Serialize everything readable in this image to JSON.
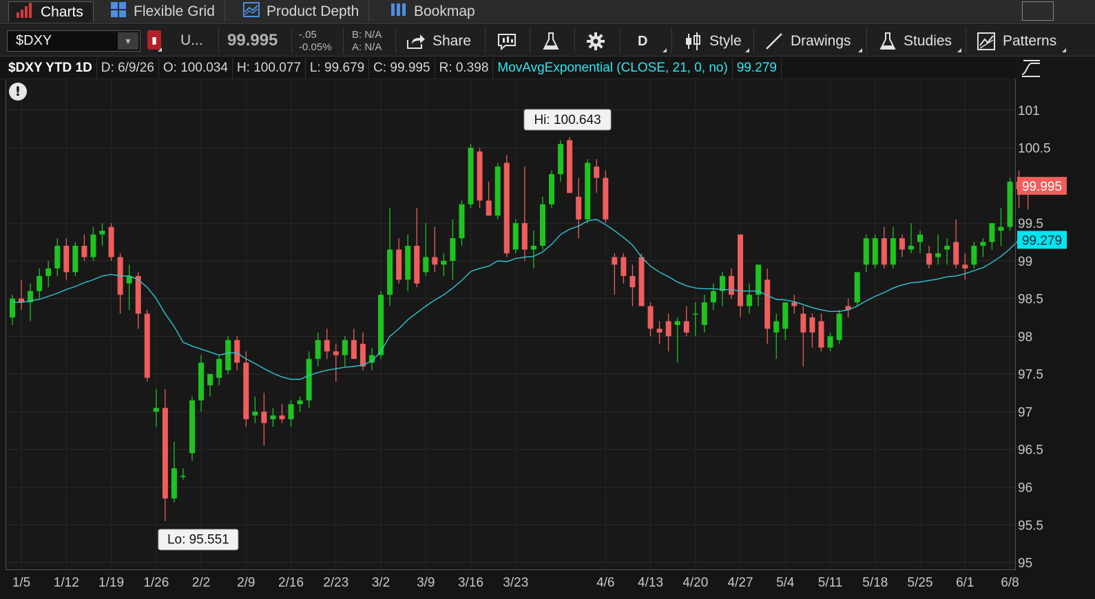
{
  "tabs": [
    {
      "label": "Charts",
      "active": true
    },
    {
      "label": "Flexible Grid",
      "active": false
    },
    {
      "label": "Product Depth",
      "active": false
    },
    {
      "label": "Bookmap",
      "active": false
    }
  ],
  "toolbar": {
    "symbol": "$DXY",
    "description": "U...",
    "last": "99.995",
    "net_change": "-.05",
    "pct_change": "-0.05%",
    "bid": "B: N/A",
    "ask": "A: N/A",
    "share_label": "Share",
    "aggregation": "D",
    "style_label": "Style",
    "drawings_label": "Drawings",
    "studies_label": "Studies",
    "patterns_label": "Patterns"
  },
  "infobar": {
    "title": "$DXY YTD 1D",
    "date": "D: 6/9/26",
    "open": "O: 100.034",
    "high": "H: 100.077",
    "low": "L: 99.679",
    "close": "C: 99.995",
    "range": "R: 0.398",
    "study": "MovAvgExponential (CLOSE, 21, 0, no)",
    "study_value": "99.279"
  },
  "colors": {
    "up": "#1fc31f",
    "down": "#ef5d5d",
    "ema": "#2ec7d3",
    "price_bubble": "#ef5d5d",
    "ema_bubble": "#00e5f0"
  },
  "chart_data": {
    "type": "candlestick",
    "title": "$DXY YTD 1D",
    "ylim": [
      94.9,
      101.4
    ],
    "y_ticks": [
      "95",
      "95.5",
      "96",
      "96.5",
      "97",
      "97.5",
      "98",
      "98.5",
      "99",
      "99.5",
      "100.5",
      "101"
    ],
    "x_tick_labels": [
      {
        "label": "1/5",
        "index": 1
      },
      {
        "label": "1/12",
        "index": 6
      },
      {
        "label": "1/19",
        "index": 11
      },
      {
        "label": "1/26",
        "index": 16
      },
      {
        "label": "2/2",
        "index": 21
      },
      {
        "label": "2/9",
        "index": 26
      },
      {
        "label": "2/16",
        "index": 31
      },
      {
        "label": "2/23",
        "index": 36
      },
      {
        "label": "3/2",
        "index": 41
      },
      {
        "label": "3/9",
        "index": 46
      },
      {
        "label": "3/16",
        "index": 51
      },
      {
        "label": "3/23",
        "index": 56
      },
      {
        "label": "4/6",
        "index": 66
      },
      {
        "label": "4/13",
        "index": 71
      },
      {
        "label": "4/20",
        "index": 76
      },
      {
        "label": "4/27",
        "index": 81
      },
      {
        "label": "5/4",
        "index": 86
      },
      {
        "label": "5/11",
        "index": 91
      },
      {
        "label": "5/18",
        "index": 96
      },
      {
        "label": "5/25",
        "index": 101
      },
      {
        "label": "6/1",
        "index": 106
      },
      {
        "label": "6/8",
        "index": 111
      }
    ],
    "hi_label": "Hi: 100.643",
    "hi_index": 61,
    "hi_value": 100.643,
    "lo_label": "Lo: 95.551",
    "lo_index": 17,
    "lo_value": 95.551,
    "last_price_label": "99.995",
    "last_price": 99.995,
    "ema_label": "99.279",
    "ema_last": 99.279,
    "candles": [
      {
        "o": 98.25,
        "h": 98.55,
        "l": 98.15,
        "c": 98.5
      },
      {
        "o": 98.5,
        "h": 98.75,
        "l": 98.35,
        "c": 98.45
      },
      {
        "o": 98.45,
        "h": 98.7,
        "l": 98.2,
        "c": 98.6
      },
      {
        "o": 98.6,
        "h": 98.9,
        "l": 98.5,
        "c": 98.8
      },
      {
        "o": 98.8,
        "h": 99.0,
        "l": 98.65,
        "c": 98.9
      },
      {
        "o": 98.9,
        "h": 99.3,
        "l": 98.8,
        "c": 99.2
      },
      {
        "o": 99.2,
        "h": 99.3,
        "l": 98.75,
        "c": 98.85
      },
      {
        "o": 98.85,
        "h": 99.25,
        "l": 98.8,
        "c": 99.2
      },
      {
        "o": 99.2,
        "h": 99.35,
        "l": 99.0,
        "c": 99.05
      },
      {
        "o": 99.05,
        "h": 99.45,
        "l": 99.0,
        "c": 99.35
      },
      {
        "o": 99.35,
        "h": 99.5,
        "l": 99.2,
        "c": 99.4
      },
      {
        "o": 99.45,
        "h": 99.5,
        "l": 99.0,
        "c": 99.05
      },
      {
        "o": 99.05,
        "h": 99.1,
        "l": 98.3,
        "c": 98.55
      },
      {
        "o": 98.7,
        "h": 98.95,
        "l": 98.35,
        "c": 98.8
      },
      {
        "o": 98.8,
        "h": 98.85,
        "l": 98.1,
        "c": 98.3
      },
      {
        "o": 98.3,
        "h": 98.35,
        "l": 97.4,
        "c": 97.45
      },
      {
        "o": 97.0,
        "h": 97.3,
        "l": 96.8,
        "c": 97.05
      },
      {
        "o": 97.05,
        "h": 97.3,
        "l": 95.55,
        "c": 95.85
      },
      {
        "o": 95.85,
        "h": 96.6,
        "l": 95.8,
        "c": 96.25
      },
      {
        "o": 96.15,
        "h": 96.25,
        "l": 96.1,
        "c": 96.15
      },
      {
        "o": 96.45,
        "h": 97.2,
        "l": 96.35,
        "c": 97.15
      },
      {
        "o": 97.15,
        "h": 97.75,
        "l": 97.0,
        "c": 97.65
      },
      {
        "o": 97.35,
        "h": 97.5,
        "l": 97.2,
        "c": 97.5
      },
      {
        "o": 97.45,
        "h": 97.75,
        "l": 97.35,
        "c": 97.7
      },
      {
        "o": 97.55,
        "h": 98.0,
        "l": 97.5,
        "c": 97.95
      },
      {
        "o": 97.95,
        "h": 98.0,
        "l": 97.55,
        "c": 97.65
      },
      {
        "o": 97.65,
        "h": 97.8,
        "l": 96.8,
        "c": 96.9
      },
      {
        "o": 96.95,
        "h": 97.2,
        "l": 96.85,
        "c": 97.0
      },
      {
        "o": 97.0,
        "h": 97.25,
        "l": 96.55,
        "c": 96.85
      },
      {
        "o": 96.9,
        "h": 97.05,
        "l": 96.8,
        "c": 96.95
      },
      {
        "o": 96.95,
        "h": 97.1,
        "l": 96.85,
        "c": 96.9
      },
      {
        "o": 96.9,
        "h": 97.15,
        "l": 96.8,
        "c": 97.1
      },
      {
        "o": 97.1,
        "h": 97.2,
        "l": 97.0,
        "c": 97.15
      },
      {
        "o": 97.15,
        "h": 97.8,
        "l": 97.05,
        "c": 97.7
      },
      {
        "o": 97.7,
        "h": 98.05,
        "l": 97.6,
        "c": 97.95
      },
      {
        "o": 97.95,
        "h": 98.1,
        "l": 97.7,
        "c": 97.8
      },
      {
        "o": 97.8,
        "h": 97.9,
        "l": 97.4,
        "c": 97.75
      },
      {
        "o": 97.75,
        "h": 98.0,
        "l": 97.6,
        "c": 97.95
      },
      {
        "o": 97.95,
        "h": 98.1,
        "l": 97.7,
        "c": 97.7
      },
      {
        "o": 97.9,
        "h": 98.05,
        "l": 97.55,
        "c": 97.6
      },
      {
        "o": 97.65,
        "h": 97.85,
        "l": 97.55,
        "c": 97.75
      },
      {
        "o": 97.75,
        "h": 98.6,
        "l": 97.7,
        "c": 98.55
      },
      {
        "o": 98.55,
        "h": 99.7,
        "l": 98.4,
        "c": 99.15
      },
      {
        "o": 99.15,
        "h": 99.3,
        "l": 98.7,
        "c": 98.75
      },
      {
        "o": 98.75,
        "h": 99.35,
        "l": 98.6,
        "c": 99.2
      },
      {
        "o": 99.2,
        "h": 99.7,
        "l": 98.65,
        "c": 98.7
      },
      {
        "o": 98.85,
        "h": 99.5,
        "l": 98.8,
        "c": 99.05
      },
      {
        "o": 99.05,
        "h": 99.45,
        "l": 98.85,
        "c": 98.95
      },
      {
        "o": 98.95,
        "h": 99.1,
        "l": 98.8,
        "c": 99.0
      },
      {
        "o": 99.0,
        "h": 99.55,
        "l": 98.75,
        "c": 99.3
      },
      {
        "o": 99.3,
        "h": 99.8,
        "l": 99.2,
        "c": 99.75
      },
      {
        "o": 99.75,
        "h": 100.55,
        "l": 99.7,
        "c": 100.5
      },
      {
        "o": 100.45,
        "h": 100.5,
        "l": 99.7,
        "c": 99.8
      },
      {
        "o": 99.8,
        "h": 100.05,
        "l": 99.6,
        "c": 99.6
      },
      {
        "o": 99.6,
        "h": 100.3,
        "l": 99.55,
        "c": 100.25
      },
      {
        "o": 100.3,
        "h": 100.4,
        "l": 99.05,
        "c": 99.1
      },
      {
        "o": 99.15,
        "h": 99.55,
        "l": 99.1,
        "c": 99.5
      },
      {
        "o": 99.5,
        "h": 100.25,
        "l": 99.0,
        "c": 99.15
      },
      {
        "o": 99.15,
        "h": 99.4,
        "l": 98.9,
        "c": 99.2
      },
      {
        "o": 99.2,
        "h": 99.85,
        "l": 99.15,
        "c": 99.75
      },
      {
        "o": 99.75,
        "h": 100.2,
        "l": 99.7,
        "c": 100.15
      },
      {
        "o": 100.15,
        "h": 100.6,
        "l": 100.05,
        "c": 100.55
      },
      {
        "o": 100.6,
        "h": 100.64,
        "l": 99.9,
        "c": 99.9
      },
      {
        "o": 99.85,
        "h": 100.1,
        "l": 99.3,
        "c": 99.55
      },
      {
        "o": 99.55,
        "h": 100.35,
        "l": 99.5,
        "c": 100.3
      },
      {
        "o": 100.25,
        "h": 100.35,
        "l": 99.9,
        "c": 100.1
      },
      {
        "o": 100.1,
        "h": 100.2,
        "l": 99.5,
        "c": 99.55
      },
      {
        "o": 99.05,
        "h": 99.1,
        "l": 98.55,
        "c": 98.95
      },
      {
        "o": 99.05,
        "h": 99.1,
        "l": 98.7,
        "c": 98.8
      },
      {
        "o": 98.8,
        "h": 98.95,
        "l": 98.4,
        "c": 98.65
      },
      {
        "o": 99.05,
        "h": 99.1,
        "l": 98.4,
        "c": 98.4
      },
      {
        "o": 98.4,
        "h": 98.45,
        "l": 98.0,
        "c": 98.1
      },
      {
        "o": 98.1,
        "h": 98.2,
        "l": 97.9,
        "c": 98.05
      },
      {
        "o": 98.2,
        "h": 98.3,
        "l": 97.8,
        "c": 98.0
      },
      {
        "o": 98.15,
        "h": 98.25,
        "l": 97.65,
        "c": 98.2
      },
      {
        "o": 98.2,
        "h": 98.4,
        "l": 98.0,
        "c": 98.05
      },
      {
        "o": 98.3,
        "h": 98.45,
        "l": 98.0,
        "c": 98.3
      },
      {
        "o": 98.15,
        "h": 98.55,
        "l": 98.05,
        "c": 98.45
      },
      {
        "o": 98.45,
        "h": 98.7,
        "l": 98.35,
        "c": 98.6
      },
      {
        "o": 98.6,
        "h": 98.85,
        "l": 98.4,
        "c": 98.8
      },
      {
        "o": 98.8,
        "h": 98.9,
        "l": 98.5,
        "c": 98.55
      },
      {
        "o": 99.35,
        "h": 99.35,
        "l": 98.25,
        "c": 98.4
      },
      {
        "o": 98.4,
        "h": 98.7,
        "l": 98.3,
        "c": 98.55
      },
      {
        "o": 98.55,
        "h": 98.95,
        "l": 98.4,
        "c": 98.95
      },
      {
        "o": 98.75,
        "h": 98.9,
        "l": 97.9,
        "c": 98.1
      },
      {
        "o": 98.05,
        "h": 98.3,
        "l": 97.7,
        "c": 98.2
      },
      {
        "o": 98.1,
        "h": 98.45,
        "l": 97.95,
        "c": 98.45
      },
      {
        "o": 98.45,
        "h": 98.55,
        "l": 98.3,
        "c": 98.4
      },
      {
        "o": 98.3,
        "h": 98.4,
        "l": 97.6,
        "c": 98.05
      },
      {
        "o": 98.25,
        "h": 98.3,
        "l": 97.85,
        "c": 98.05
      },
      {
        "o": 98.2,
        "h": 98.3,
        "l": 97.8,
        "c": 97.85
      },
      {
        "o": 97.85,
        "h": 98.05,
        "l": 97.8,
        "c": 98.0
      },
      {
        "o": 97.95,
        "h": 98.35,
        "l": 97.9,
        "c": 98.3
      },
      {
        "o": 98.4,
        "h": 98.5,
        "l": 98.25,
        "c": 98.35
      },
      {
        "o": 98.45,
        "h": 98.85,
        "l": 98.4,
        "c": 98.85
      },
      {
        "o": 98.95,
        "h": 99.35,
        "l": 98.85,
        "c": 99.3
      },
      {
        "o": 98.95,
        "h": 99.35,
        "l": 98.9,
        "c": 99.3
      },
      {
        "o": 99.3,
        "h": 99.45,
        "l": 98.9,
        "c": 98.95
      },
      {
        "o": 98.95,
        "h": 99.45,
        "l": 98.9,
        "c": 99.3
      },
      {
        "o": 99.3,
        "h": 99.35,
        "l": 99.05,
        "c": 99.15
      },
      {
        "o": 99.15,
        "h": 99.5,
        "l": 99.1,
        "c": 99.2
      },
      {
        "o": 99.25,
        "h": 99.4,
        "l": 99.1,
        "c": 99.35
      },
      {
        "o": 99.1,
        "h": 99.2,
        "l": 98.9,
        "c": 98.95
      },
      {
        "o": 99.05,
        "h": 99.35,
        "l": 98.95,
        "c": 99.1
      },
      {
        "o": 99.15,
        "h": 99.3,
        "l": 98.95,
        "c": 99.2
      },
      {
        "o": 99.25,
        "h": 99.55,
        "l": 98.9,
        "c": 98.95
      },
      {
        "o": 98.95,
        "h": 99.1,
        "l": 98.75,
        "c": 98.9
      },
      {
        "o": 98.95,
        "h": 99.25,
        "l": 98.9,
        "c": 99.2
      },
      {
        "o": 99.2,
        "h": 99.3,
        "l": 99.05,
        "c": 99.25
      },
      {
        "o": 99.25,
        "h": 99.5,
        "l": 99.15,
        "c": 99.5
      },
      {
        "o": 99.4,
        "h": 99.7,
        "l": 99.2,
        "c": 99.45
      },
      {
        "o": 99.45,
        "h": 100.1,
        "l": 99.4,
        "c": 100.05
      },
      {
        "o": 100.05,
        "h": 100.2,
        "l": 99.7,
        "c": 99.95
      },
      {
        "o": 100.03,
        "h": 100.08,
        "l": 99.68,
        "c": 99.995
      }
    ],
    "ema_series": [
      98.45,
      98.45,
      98.47,
      98.49,
      98.53,
      98.57,
      98.62,
      98.66,
      98.71,
      98.75,
      98.8,
      98.82,
      98.8,
      98.8,
      98.75,
      98.65,
      98.5,
      98.3,
      98.13,
      97.92,
      97.87,
      97.83,
      97.79,
      97.75,
      97.78,
      97.78,
      97.7,
      97.64,
      97.57,
      97.51,
      97.46,
      97.43,
      97.43,
      97.48,
      97.52,
      97.55,
      97.57,
      97.59,
      97.6,
      97.62,
      97.67,
      97.8,
      98.0,
      98.1,
      98.22,
      98.31,
      98.4,
      98.48,
      98.55,
      98.64,
      98.74,
      98.86,
      98.9,
      98.93,
      99.0,
      98.99,
      99.03,
      99.05,
      99.06,
      99.12,
      99.22,
      99.35,
      99.42,
      99.46,
      99.53,
      99.55,
      99.48,
      99.4,
      99.31,
      99.21,
      99.05,
      98.93,
      98.85,
      98.79,
      98.72,
      98.67,
      98.64,
      98.63,
      98.63,
      98.62,
      98.62,
      98.6,
      98.6,
      98.6,
      98.54,
      98.49,
      98.48,
      98.46,
      98.42,
      98.38,
      98.35,
      98.33,
      98.33,
      98.35,
      98.4,
      98.47,
      98.53,
      98.58,
      98.64,
      98.68,
      98.71,
      98.72,
      98.74,
      98.76,
      98.79,
      98.8,
      98.83,
      98.87,
      98.91,
      98.98,
      99.06,
      99.16,
      99.279
    ]
  }
}
